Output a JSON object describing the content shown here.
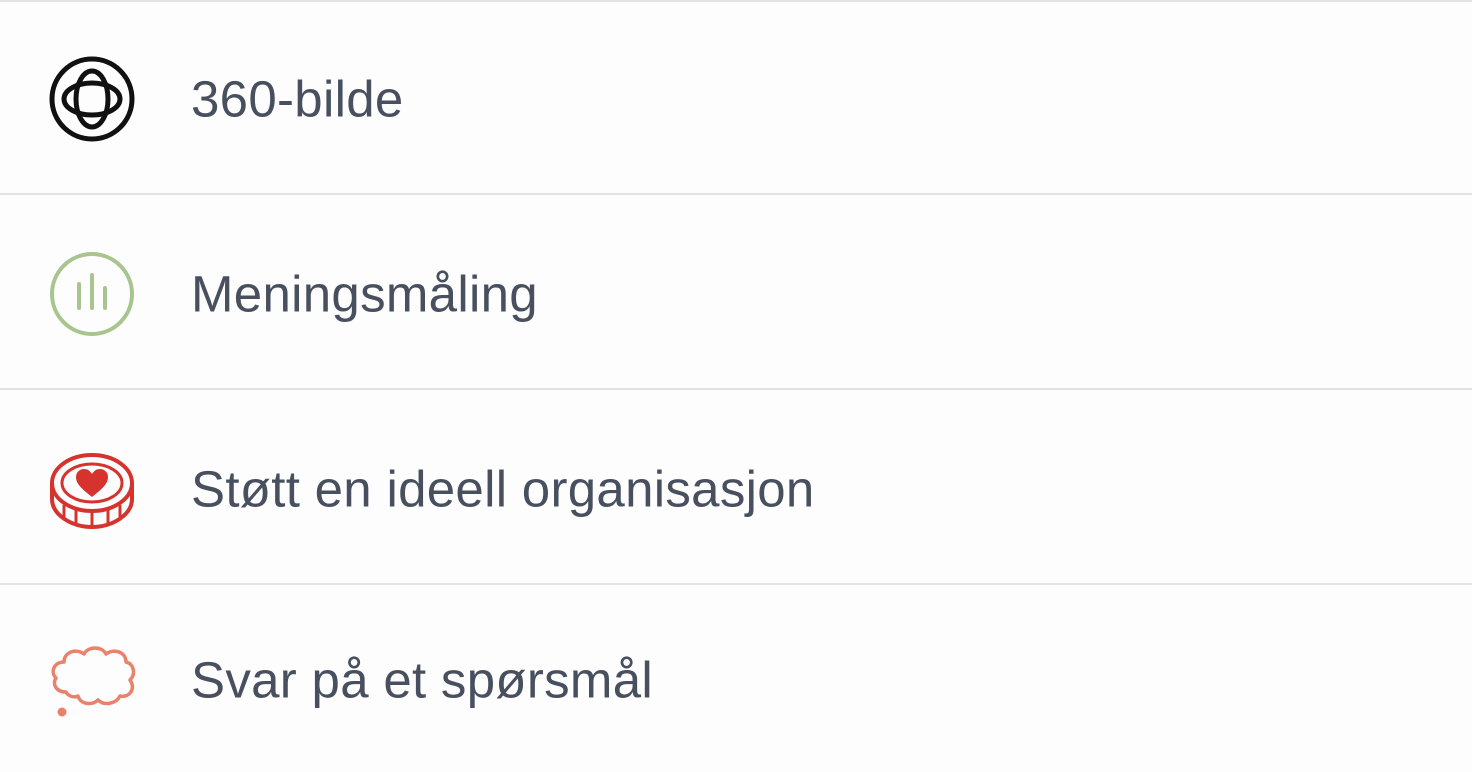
{
  "menu": {
    "items": [
      {
        "label": "360-bilde",
        "icon": "360-photo-icon",
        "icon_color": "#111111"
      },
      {
        "label": "Meningsmåling",
        "icon": "poll-chart-icon",
        "icon_color": "#a8c48f"
      },
      {
        "label": "Støtt en ideell organisasjon",
        "icon": "heart-coin-icon",
        "icon_color": "#d6332e"
      },
      {
        "label": "Svar på et spørsmål",
        "icon": "thought-bubble-icon",
        "icon_color": "#e8826b"
      }
    ]
  },
  "colors": {
    "text": "#48505f",
    "divider": "#e2e2e2",
    "background": "#fdfdfd"
  }
}
